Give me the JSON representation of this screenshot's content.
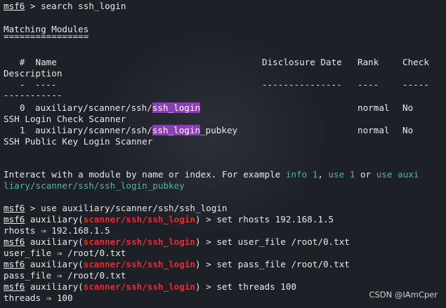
{
  "prompt": "msf6",
  "lines": {
    "cmd_search": " > search ssh_login",
    "matching_title": "Matching Modules",
    "matching_ul": "================",
    "col_num": "   #  ",
    "col_name": "Name",
    "col_disclosure": "Disclosure Date",
    "col_rank": "Rank",
    "col_check": "Check",
    "col_description": "Description",
    "dash_num": "-",
    "dash_name": "----",
    "dash_disclosure": "---------------",
    "dash_rank": "----",
    "dash_check": "-----",
    "dash_description": "-----------"
  },
  "results": [
    {
      "index": "0",
      "prefix": "auxiliary/scanner/ssh/",
      "match": "ssh_login",
      "suffix": "",
      "rank": "normal",
      "check": "No",
      "description": "SSH Login Check Scanner"
    },
    {
      "index": "1",
      "prefix": "auxiliary/scanner/ssh/",
      "match": "ssh_login",
      "suffix": "_pubkey",
      "rank": "normal",
      "check": "No",
      "description": "SSH Public Key Login Scanner"
    }
  ],
  "interact": {
    "text1": "Interact with a module by name or index. For example ",
    "info": "info 1",
    "sep1": ", ",
    "use": "use 1",
    "sep2": " or ",
    "use_auxi": "use auxi",
    "wrap": "liary/scanner/ssh/ssh_login_pubkey"
  },
  "session": {
    "cmd_use": " > use auxiliary/scanner/ssh/ssh_login",
    "module_prefix": " auxiliary(",
    "module_name": "scanner/ssh/ssh_login",
    "module_suffix": ")",
    "cmd_rhosts": " > set rhosts 192.168.1.5",
    "out_rhosts": "rhosts ⇒ 192.168.1.5",
    "cmd_user_file": " > set user_file /root/0.txt",
    "out_user_file": "user_file ⇒ /root/0.txt",
    "cmd_pass_file": " > set pass_file /root/0.txt",
    "out_pass_file": "pass_file ⇒ /root/0.txt",
    "cmd_threads": " > set threads 100",
    "out_threads": "threads ⇒ 100"
  },
  "watermark": "CSDN @IAmCper"
}
